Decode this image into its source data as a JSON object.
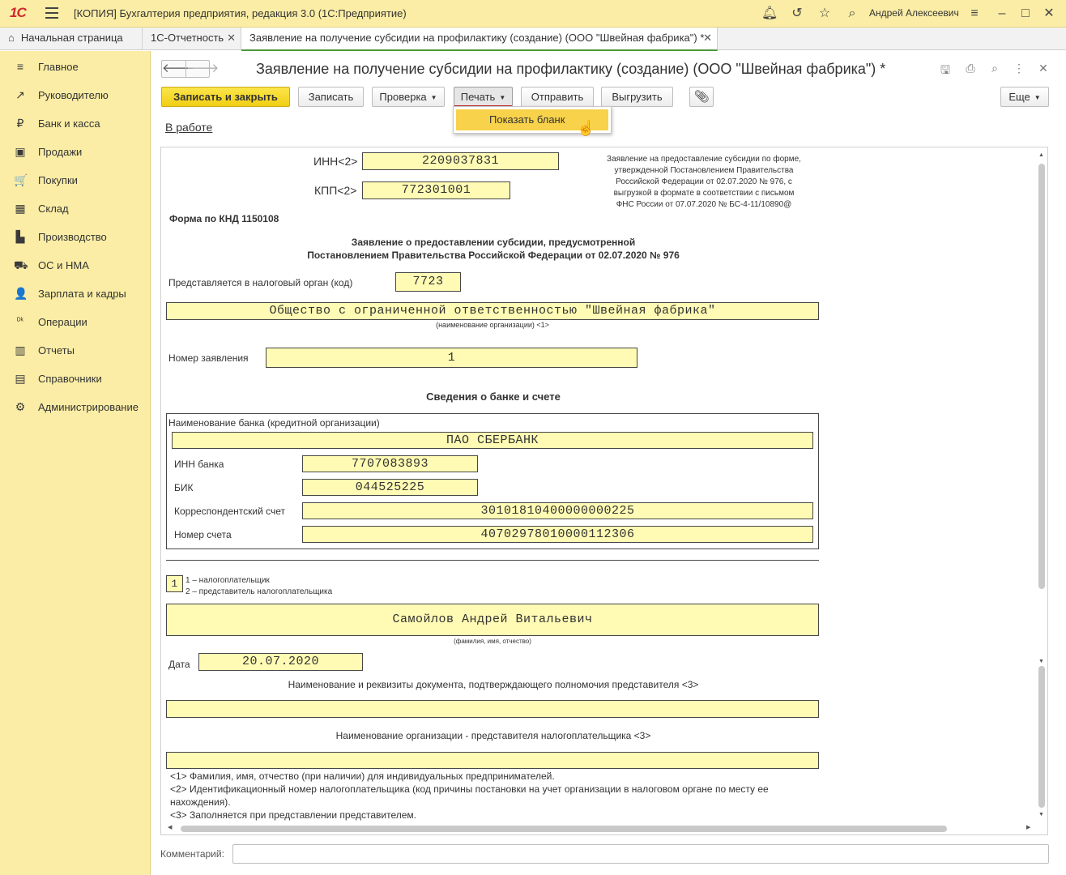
{
  "app": {
    "logo": "1С",
    "title": "[КОПИЯ] Бухгалтерия предприятия, редакция 3.0  (1С:Предприятие)",
    "user": "Андрей Алексеевич"
  },
  "tabs": [
    {
      "label": "Начальная страница"
    },
    {
      "label": "1С-Отчетность"
    },
    {
      "label": "Заявление на получение субсидии на профилактику (создание) (ООО \"Швейная фабрика\") *"
    }
  ],
  "sidebar": {
    "items": [
      {
        "label": "Главное",
        "icon": "≡"
      },
      {
        "label": "Руководителю",
        "icon": "↗"
      },
      {
        "label": "Банк и касса",
        "icon": "₽"
      },
      {
        "label": "Продажи",
        "icon": "▣"
      },
      {
        "label": "Покупки",
        "icon": "🛒"
      },
      {
        "label": "Склад",
        "icon": "▦"
      },
      {
        "label": "Производство",
        "icon": "▙"
      },
      {
        "label": "ОС и НМА",
        "icon": "⛟"
      },
      {
        "label": "Зарплата и кадры",
        "icon": "👤"
      },
      {
        "label": "Операции",
        "icon": "ᴰᵏ"
      },
      {
        "label": "Отчеты",
        "icon": "▥"
      },
      {
        "label": "Справочники",
        "icon": "▤"
      },
      {
        "label": "Администрирование",
        "icon": "⚙"
      }
    ]
  },
  "document": {
    "title": "Заявление на получение субсидии на профилактику (создание) (ООО \"Швейная фабрика\") *",
    "status": "В работе"
  },
  "toolbar": {
    "save_close": "Записать и закрыть",
    "save": "Записать",
    "check": "Проверка",
    "print": "Печать",
    "send": "Отправить",
    "export": "Выгрузить",
    "more": "Еще",
    "print_menu_item": "Показать бланк"
  },
  "form": {
    "inn_label": "ИНН<2>",
    "inn": "2209037831",
    "kpp_label": "КПП<2>",
    "kpp": "772301001",
    "header_note": [
      "Заявление на предоставление субсидии по форме,",
      "утвержденной Постановлением Правительства",
      "Российской Федерации от 02.07.2020 № 976, с",
      "выгрузкой в формате в соответствии с письмом",
      "ФНС России от 07.07.2020 № БС-4-11/10890@"
    ],
    "knd": "Форма по КНД 1150108",
    "heading1": "Заявление о предоставлении субсидии, предусмотренной",
    "heading2": "Постановлением Правительства Российской Федерации от 02.07.2020 № 976",
    "tax_office_label": "Представляется в налоговый орган (код)",
    "tax_office": "7723",
    "org_name": "Общество с ограниченной ответственностью \"Швейная фабрика\"",
    "org_name_caption": "(наименование организации) <1>",
    "app_number_label": "Номер заявления",
    "app_number": "1",
    "bank_heading": "Сведения о банке и счете",
    "bank_name_label": "Наименование банка (кредитной организации)",
    "bank_name": "ПАО СБЕРБАНК",
    "bank_inn_label": "ИНН банка",
    "bank_inn": "7707083893",
    "bik_label": "БИК",
    "bik": "044525225",
    "corr_label": "Корреспондентский счет",
    "corr": "30101810400000000225",
    "account_label": "Номер счета",
    "account": "40702978010000112306",
    "signer_code": "1",
    "signer_opt1": "1 – налогоплательщик",
    "signer_opt2": "2 – представитель налогоплательщика",
    "signer_name": "Самойлов Андрей Витальевич",
    "signer_caption": "(фамилия, имя, отчество)",
    "date_label": "Дата",
    "date": "20.07.2020",
    "rep_doc_label": "Наименование и реквизиты документа, подтверждающего полномочия представителя <3>",
    "rep_doc": "",
    "rep_org_label": "Наименование организации - представителя налогоплательщика <3>",
    "rep_org": "",
    "footnote1": "<1> Фамилия, имя, отчество (при наличии) для индивидуальных предпринимателей.",
    "footnote2a": "<2> Идентификационный номер налогоплательщика (код причины постановки на учет организации в налоговом органе по месту ее",
    "footnote2b": "нахождения).",
    "footnote3": "<3> Заполняется при представлении представителем."
  },
  "comment": {
    "label": "Комментарий:",
    "value": ""
  }
}
